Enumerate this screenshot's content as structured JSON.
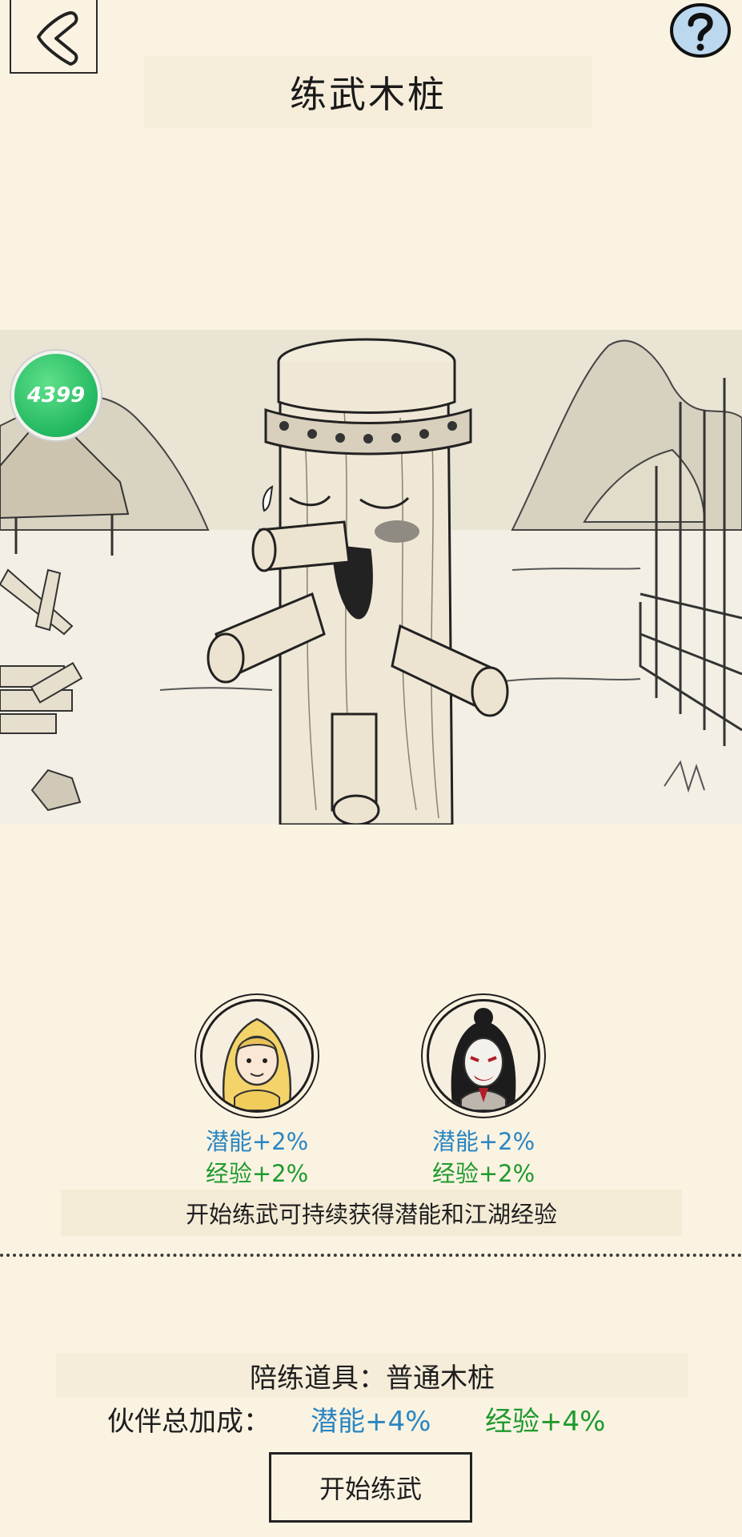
{
  "header": {
    "back_icon": "back-arrow-icon",
    "help_icon": "question-mark-icon",
    "title": "练武木桩"
  },
  "scene": {
    "badge_text": "4399",
    "illustration": "wooden-training-dummy"
  },
  "partners": [
    {
      "portrait_icon": "yellow-hood-girl-avatar",
      "potential": "潜能+2%",
      "experience": "经验+2%"
    },
    {
      "portrait_icon": "masked-swordswoman-avatar",
      "potential": "潜能+2%",
      "experience": "经验+2%"
    }
  ],
  "tip": "开始练武可持续获得潜能和江湖经验",
  "equipment": {
    "label": "陪练道具：普通木桩"
  },
  "bonus": {
    "label": "伙伴总加成：",
    "potential": "潜能+4%",
    "experience": "经验+4%"
  },
  "start_button": "开始练武",
  "colors": {
    "background": "#fbf3e2",
    "potential": "#2a86c1",
    "experience": "#1e9a2e",
    "badge": "#22b860"
  }
}
